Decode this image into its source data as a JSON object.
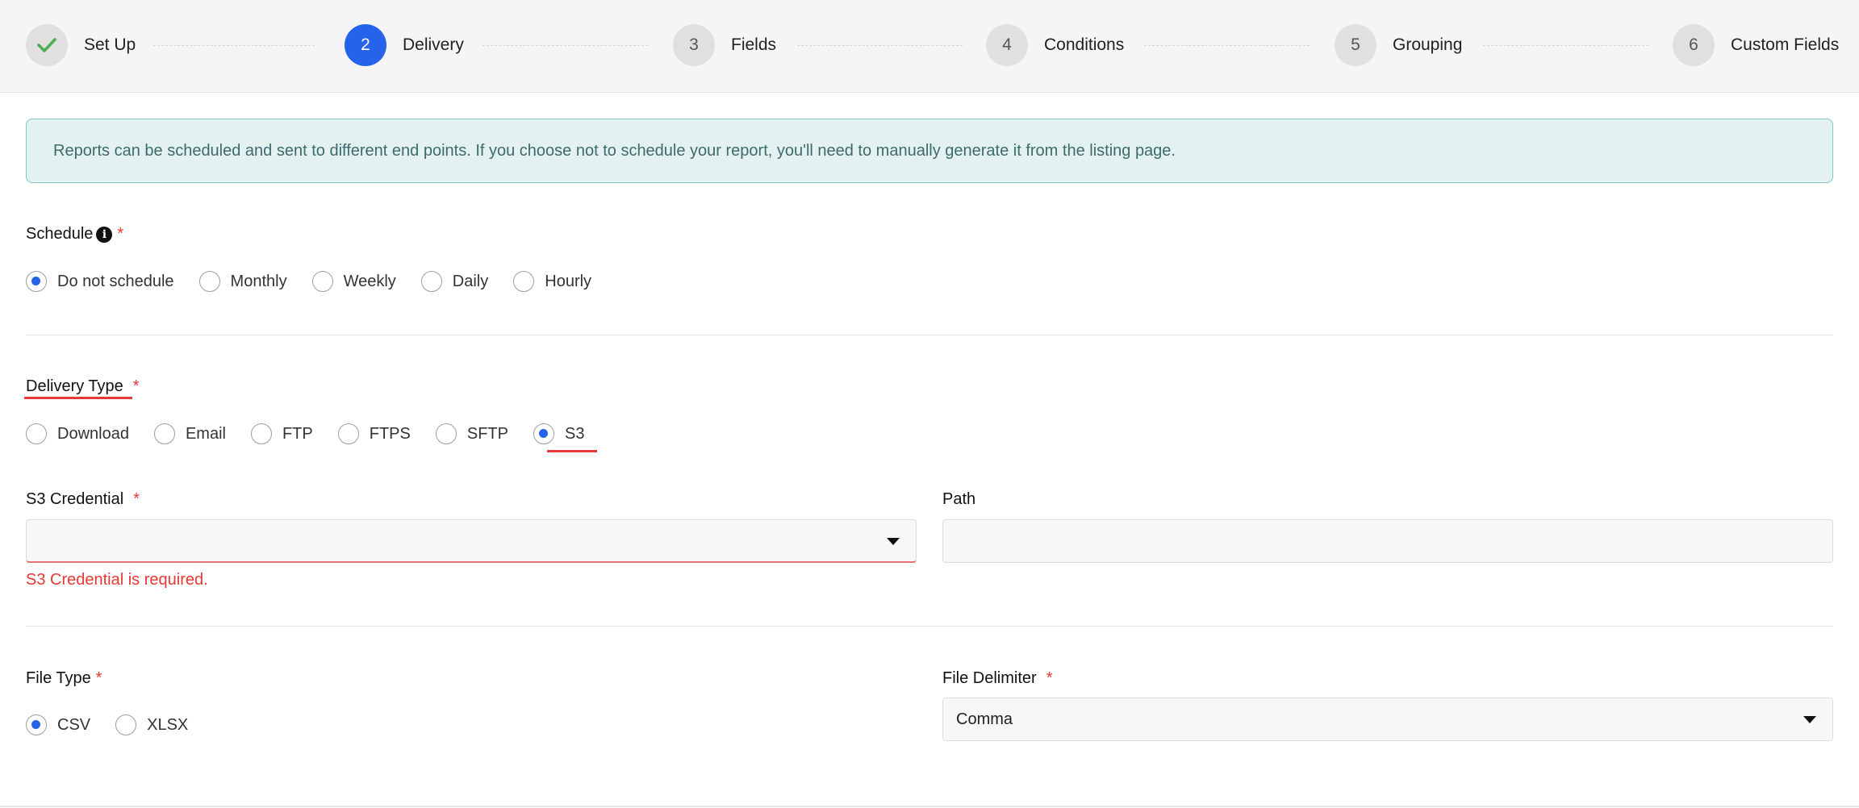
{
  "stepper": {
    "steps": [
      {
        "marker": "✓",
        "label": "Set Up",
        "state": "complete"
      },
      {
        "marker": "2",
        "label": "Delivery",
        "state": "active"
      },
      {
        "marker": "3",
        "label": "Fields",
        "state": "pending"
      },
      {
        "marker": "4",
        "label": "Conditions",
        "state": "pending"
      },
      {
        "marker": "5",
        "label": "Grouping",
        "state": "pending"
      },
      {
        "marker": "6",
        "label": "Custom Fields",
        "state": "pending"
      }
    ]
  },
  "info_banner": {
    "text": "Reports can be scheduled and sent to different end points. If you choose not to schedule your report, you'll need to manually generate it from the listing page."
  },
  "schedule": {
    "label": "Schedule",
    "info_icon": "info-icon",
    "required": "*",
    "options": [
      "Do not schedule",
      "Monthly",
      "Weekly",
      "Daily",
      "Hourly"
    ],
    "selected": "Do not schedule"
  },
  "delivery_type": {
    "label": "Delivery Type",
    "required": "*",
    "options": [
      "Download",
      "Email",
      "FTP",
      "FTPS",
      "SFTP",
      "S3"
    ],
    "selected": "S3"
  },
  "s3_credential": {
    "label": "S3 Credential",
    "required": "*",
    "value": "",
    "error": "S3 Credential is required."
  },
  "path": {
    "label": "Path",
    "value": ""
  },
  "file_type": {
    "label": "File Type",
    "required": "*",
    "options": [
      "CSV",
      "XLSX"
    ],
    "selected": "CSV"
  },
  "file_delimiter": {
    "label": "File Delimiter",
    "required": "*",
    "value": "Comma"
  },
  "colors": {
    "accent": "#2563eb",
    "error": "#e53935",
    "banner_bg": "#e3f1f1",
    "complete_check": "#4caf50"
  }
}
